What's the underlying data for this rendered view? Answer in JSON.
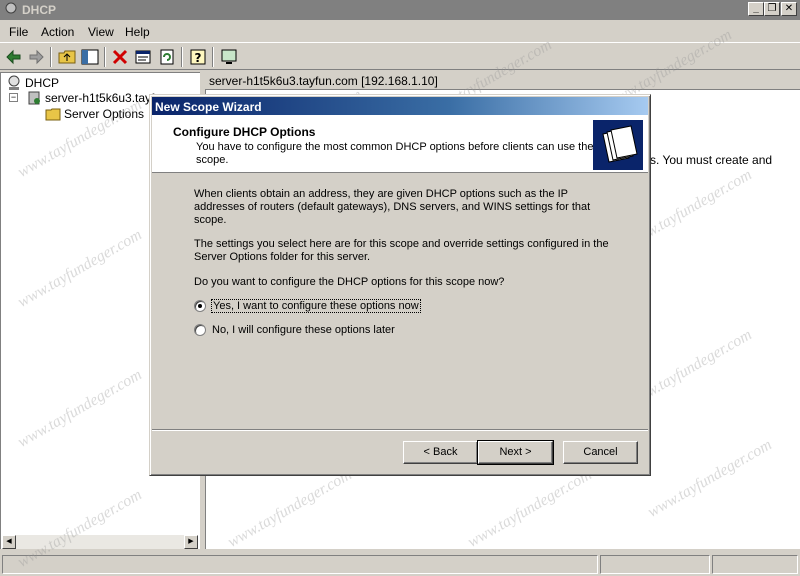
{
  "window": {
    "title": "DHCP"
  },
  "menu": [
    {
      "label": "File",
      "accel": "F"
    },
    {
      "label": "Action",
      "accel": "A"
    },
    {
      "label": "View",
      "accel": "V"
    },
    {
      "label": "Help",
      "accel": "H"
    }
  ],
  "tree": {
    "root": "DHCP",
    "server": "server-h1t5k6u3.tayf",
    "child": "Server Options"
  },
  "right_pane": {
    "header": "server-h1t5k6u3.tayfun.com [192.168.1.10]",
    "text_fragment": "s. You must create and"
  },
  "wizard": {
    "title": "New Scope Wizard",
    "heading": "Configure DHCP Options",
    "subheading": "You have to configure the most common DHCP options before clients can use the scope.",
    "para1": "When clients obtain an address, they are given DHCP options such as the IP addresses of routers (default gateways), DNS servers, and WINS settings for that scope.",
    "para2": "The settings you select here are for this scope and override settings configured in the Server Options folder for this server.",
    "question": "Do you want to configure the DHCP options for this scope now?",
    "option_yes": "Yes, I want to configure these options now",
    "option_no": "No, I will configure these options later",
    "selected": "yes",
    "back_label": "< Back",
    "next_label": "Next >",
    "cancel_label": "Cancel"
  },
  "watermark": "www.tayfundeger.com"
}
